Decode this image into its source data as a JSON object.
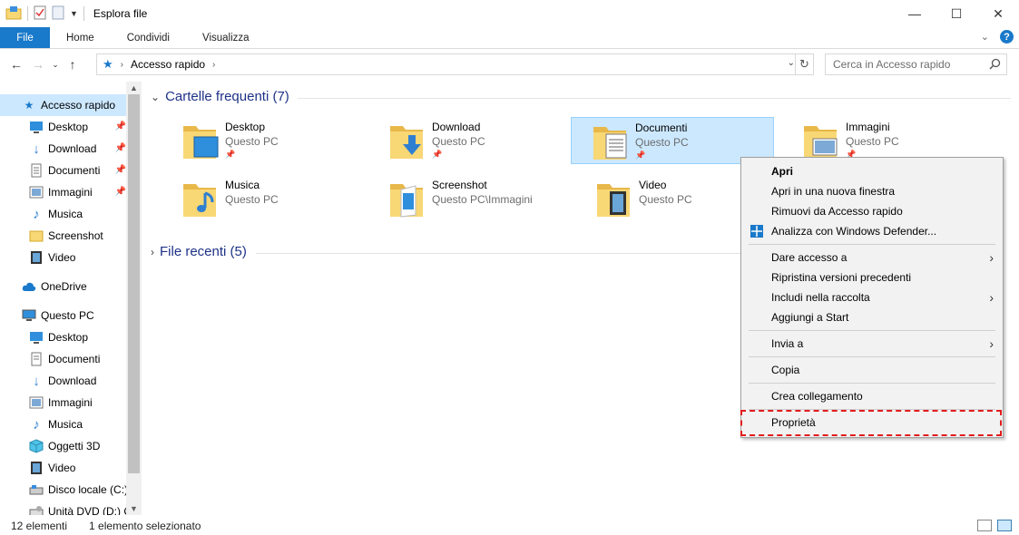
{
  "window": {
    "title": "Esplora file",
    "controls": {
      "minimize": "—",
      "maximize": "☐",
      "close": "✕"
    }
  },
  "ribbon": {
    "tabs": [
      "File",
      "Home",
      "Condividi",
      "Visualizza"
    ],
    "help": "?"
  },
  "address": {
    "crumb": "Accesso rapido",
    "search_placeholder": "Cerca in Accesso rapido"
  },
  "sidebar": {
    "quick_access": "Accesso rapido",
    "quick_items": [
      "Desktop",
      "Download",
      "Documenti",
      "Immagini",
      "Musica",
      "Screenshot",
      "Video"
    ],
    "onedrive": "OneDrive",
    "this_pc": "Questo PC",
    "pc_items": [
      "Desktop",
      "Documenti",
      "Download",
      "Immagini",
      "Musica",
      "Oggetti 3D",
      "Video",
      "Disco locale (C:)",
      "Unità DVD (D:) C"
    ]
  },
  "main": {
    "frequent_header": "Cartelle frequenti (7)",
    "recent_header": "File recenti (5)",
    "folders": [
      {
        "name": "Desktop",
        "location": "Questo PC",
        "pinned": true
      },
      {
        "name": "Download",
        "location": "Questo PC",
        "pinned": true
      },
      {
        "name": "Documenti",
        "location": "Questo PC",
        "pinned": true
      },
      {
        "name": "Immagini",
        "location": "Questo PC",
        "pinned": true
      },
      {
        "name": "Musica",
        "location": "Questo PC",
        "pinned": false
      },
      {
        "name": "Screenshot",
        "location": "Questo PC\\Immagini",
        "pinned": false
      },
      {
        "name": "Video",
        "location": "Questo PC",
        "pinned": false
      }
    ]
  },
  "context_menu": {
    "open": "Apri",
    "open_new_window": "Apri in una nuova finestra",
    "remove_quick": "Rimuovi da Accesso rapido",
    "defender": "Analizza con Windows Defender...",
    "give_access": "Dare accesso a",
    "restore_versions": "Ripristina versioni precedenti",
    "include_library": "Includi nella raccolta",
    "pin_start": "Aggiungi a Start",
    "send_to": "Invia a",
    "copy": "Copia",
    "create_shortcut": "Crea collegamento",
    "properties": "Proprietà"
  },
  "status": {
    "count": "12 elementi",
    "selected": "1 elemento selezionato"
  },
  "colors": {
    "accent": "#1979ca",
    "selection": "#cce8ff",
    "highlight_border": "#e21b1b",
    "folder": "#f8d775"
  }
}
